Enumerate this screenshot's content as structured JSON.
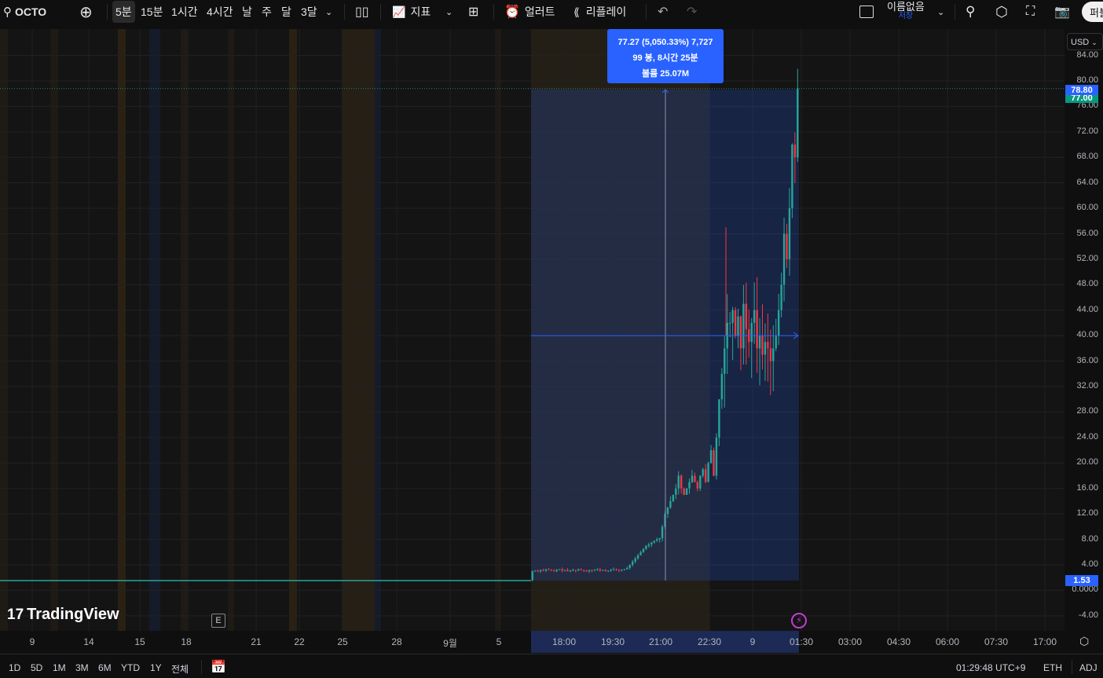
{
  "toolbar": {
    "symbol": "OCTO",
    "intervals": [
      "5분",
      "15분",
      "1시간",
      "4시간",
      "날",
      "주",
      "달",
      "3달"
    ],
    "indicators_label": "지표",
    "alert_label": "얼러트",
    "replay_label": "리플레이",
    "layout_name": "이름없음",
    "save_label": "저장",
    "publish_label": "퍼블"
  },
  "currency": "USD",
  "measure_tooltip": {
    "line1": "77.27 (5,050.33%) 7,727",
    "line2": "99 봉, 8시간 25분",
    "line3": "볼륨 25.07M"
  },
  "price_badges": {
    "high": "78.80",
    "last": "77.00",
    "low": "1.53"
  },
  "colors": {
    "up": "#26a69a",
    "down": "#f23645",
    "accent": "#2962ff"
  },
  "logo": "TradingView",
  "chart_data": {
    "type": "candlestick",
    "symbol": "OCTO",
    "interval": "5분",
    "y_ticks": [
      84,
      80,
      76,
      72,
      68,
      64,
      60,
      56,
      52,
      48,
      44,
      40,
      36,
      32,
      28,
      24,
      20,
      16,
      12,
      8,
      4,
      0,
      -4
    ],
    "y_tick_labels": [
      "84.00",
      "80.00",
      "76.00",
      "72.00",
      "68.00",
      "64.00",
      "60.00",
      "56.00",
      "52.00",
      "48.00",
      "44.00",
      "40.00",
      "36.00",
      "32.00",
      "28.00",
      "24.00",
      "20.00",
      "16.00",
      "12.00",
      "8.00",
      "4.00",
      "0.0000",
      "-4.00"
    ],
    "x_tick_labels": [
      "9",
      "14",
      "15",
      "18",
      "21",
      "22",
      "25",
      "28",
      "9월",
      "5",
      "18:00",
      "19:30",
      "21:00",
      "22:30",
      "9",
      "01:30",
      "03:00",
      "04:30",
      "06:00",
      "07:30",
      "17:00"
    ],
    "prior_flat_price": 1.53,
    "closes": [
      3.0,
      3.1,
      3.0,
      3.2,
      3.1,
      3.3,
      3.2,
      3.1,
      3.0,
      3.2,
      3.3,
      3.1,
      3.2,
      3.0,
      3.1,
      3.2,
      3.1,
      3.3,
      3.2,
      3.1,
      3.0,
      3.2,
      3.1,
      3.2,
      3.3,
      3.1,
      3.2,
      3.0,
      3.1,
      3.2,
      3.3,
      3.2,
      3.1,
      3.2,
      3.3,
      3.5,
      4.0,
      4.5,
      5.0,
      5.5,
      6.0,
      6.5,
      7.0,
      7.2,
      7.5,
      7.8,
      8.0,
      8.2,
      10,
      12,
      13,
      14,
      15,
      16,
      18,
      16,
      15,
      16,
      17,
      18,
      17,
      16,
      18,
      19,
      17,
      20,
      22,
      18,
      24,
      30,
      34,
      38,
      42,
      42,
      44,
      40,
      43,
      38,
      45,
      41,
      39,
      42,
      44,
      38,
      40,
      37,
      39,
      38,
      36,
      38,
      40,
      44,
      48,
      56,
      52,
      60,
      70,
      68,
      78.8
    ]
  },
  "bottom": {
    "ranges": [
      "1D",
      "5D",
      "1M",
      "3M",
      "6M",
      "YTD",
      "1Y",
      "전체"
    ],
    "clock": "01:29:48 UTC+9",
    "session": "ETH",
    "adj": "ADJ"
  },
  "earnings_marker": "E"
}
